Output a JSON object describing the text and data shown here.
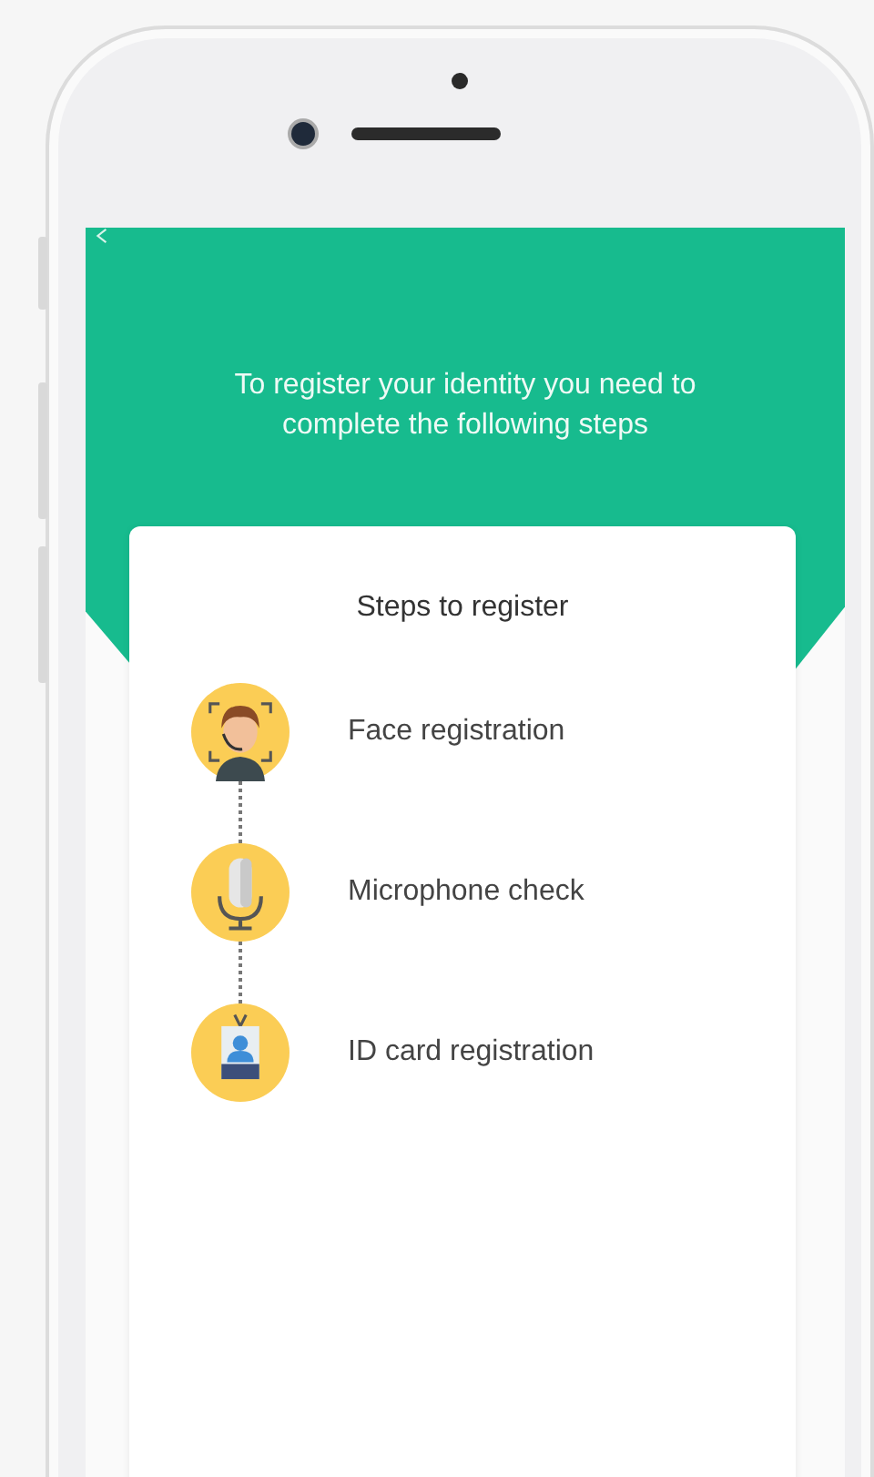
{
  "header": {
    "message": "To register your identity you need to complete the following steps"
  },
  "card": {
    "title": "Steps to register",
    "steps": [
      {
        "kind": "face",
        "label": "Face registration"
      },
      {
        "kind": "microphone",
        "label": "Microphone check"
      },
      {
        "kind": "id-card",
        "label": "ID card registration"
      }
    ]
  }
}
